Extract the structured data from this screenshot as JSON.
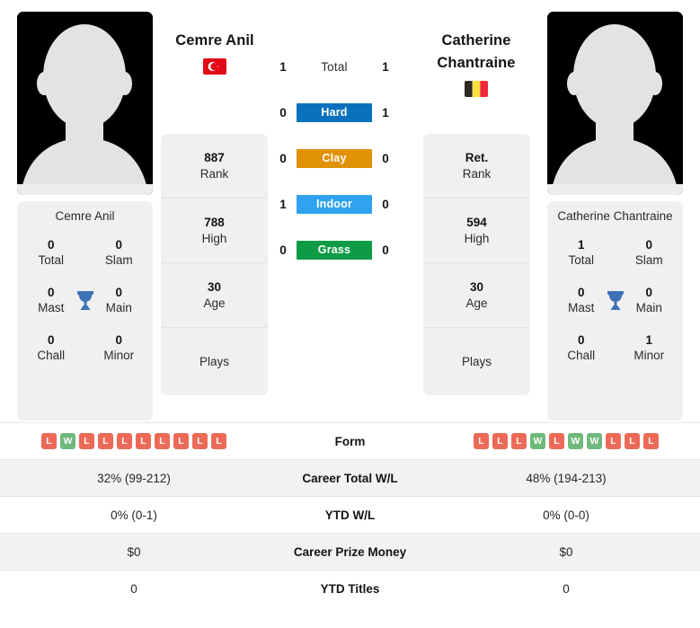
{
  "players": {
    "left": {
      "name": "Cemre Anil",
      "flag": "turkey-flag",
      "flag_colors": {
        "field": "#e30a17",
        "emblem": "#ffffff"
      },
      "avatar_label": "player-avatar-placeholder",
      "card_name": "Cemre Anil",
      "rank": "887",
      "rank_label": "Rank",
      "high": "788",
      "high_label": "High",
      "age": "30",
      "age_label": "Age",
      "plays_label": "Plays",
      "plays_value": "",
      "titles": [
        {
          "num": "0",
          "lbl": "Total"
        },
        {
          "num": "0",
          "lbl": "Slam"
        },
        {
          "num": "0",
          "lbl": "Mast"
        },
        {
          "num": "0",
          "lbl": "Main"
        },
        {
          "num": "0",
          "lbl": "Chall"
        },
        {
          "num": "0",
          "lbl": "Minor"
        }
      ],
      "form": [
        "L",
        "W",
        "L",
        "L",
        "L",
        "L",
        "L",
        "L",
        "L",
        "L"
      ],
      "career_total_wl": "32% (99-212)",
      "ytd_wl": "0% (0-1)",
      "career_prize_money": "$0",
      "ytd_titles": "0"
    },
    "right": {
      "name": "Catherine Chantraine",
      "name_line1": "Catherine",
      "name_line2": "Chantraine",
      "flag": "belgium-flag",
      "flag_colors": {
        "black": "#2d2926",
        "yellow": "#fae042",
        "red": "#ed2939"
      },
      "avatar_label": "player-avatar-placeholder",
      "card_name": "Catherine Chantraine",
      "rank": "Ret.",
      "rank_label": "Rank",
      "high": "594",
      "high_label": "High",
      "age": "30",
      "age_label": "Age",
      "plays_label": "Plays",
      "plays_value": "",
      "titles": [
        {
          "num": "1",
          "lbl": "Total"
        },
        {
          "num": "0",
          "lbl": "Slam"
        },
        {
          "num": "0",
          "lbl": "Mast"
        },
        {
          "num": "0",
          "lbl": "Main"
        },
        {
          "num": "0",
          "lbl": "Chall"
        },
        {
          "num": "1",
          "lbl": "Minor"
        }
      ],
      "form": [
        "L",
        "L",
        "L",
        "W",
        "L",
        "W",
        "W",
        "L",
        "L",
        "L"
      ],
      "career_total_wl": "48% (194-213)",
      "ytd_wl": "0% (0-0)",
      "career_prize_money": "$0",
      "ytd_titles": "0"
    }
  },
  "head_to_head": {
    "rows": [
      {
        "left": "1",
        "label": "Total",
        "right": "1",
        "color": "none"
      },
      {
        "left": "0",
        "label": "Hard",
        "right": "1",
        "color": "#0a72bd"
      },
      {
        "left": "0",
        "label": "Clay",
        "right": "0",
        "color": "#e09106"
      },
      {
        "left": "1",
        "label": "Indoor",
        "right": "0",
        "color": "#2fa3f0"
      },
      {
        "left": "0",
        "label": "Grass",
        "right": "0",
        "color": "#0d9b45"
      }
    ]
  },
  "comparison_table": {
    "rows": [
      {
        "label": "Form",
        "left": "",
        "right": "",
        "type": "form",
        "shaded": false
      },
      {
        "label": "Career Total W/L",
        "left": "32% (99-212)",
        "right": "48% (194-213)",
        "type": "text",
        "shaded": true
      },
      {
        "label": "YTD W/L",
        "left": "0% (0-1)",
        "right": "0% (0-0)",
        "type": "text",
        "shaded": false
      },
      {
        "label": "Career Prize Money",
        "left": "$0",
        "right": "$0",
        "type": "text",
        "shaded": true
      },
      {
        "label": "YTD Titles",
        "left": "0",
        "right": "0",
        "type": "text",
        "shaded": false
      }
    ]
  },
  "theme": {
    "card_bg": "#f0f0f0",
    "shaded_row": "#f2f2f2",
    "win_badge": "#70b97c",
    "loss_badge": "#ec6a57",
    "trophy": "#3f72b4"
  }
}
